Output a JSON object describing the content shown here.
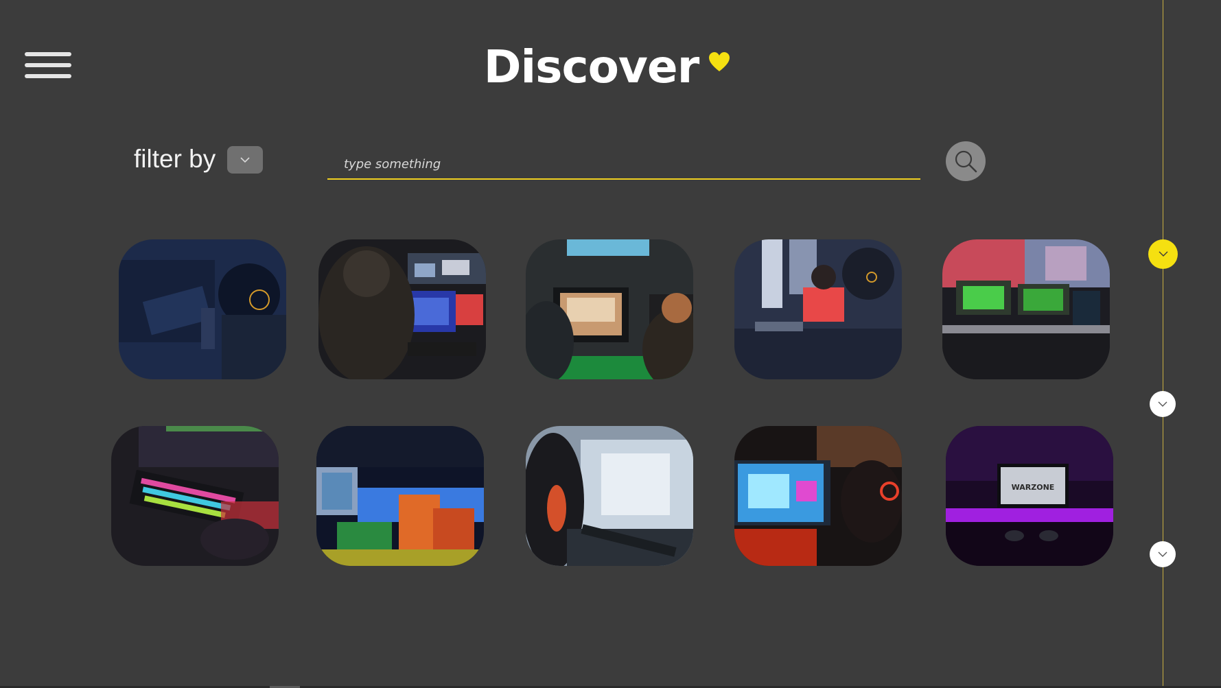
{
  "header": {
    "title": "Discover",
    "heart_icon": "heart-icon",
    "accent_color": "#f5e011"
  },
  "menu": {
    "icon": "hamburger-menu-icon"
  },
  "filter": {
    "label": "filter by",
    "dropdown_icon": "chevron-down-icon"
  },
  "search": {
    "placeholder": "type something",
    "value": "",
    "button_icon": "search-icon",
    "underline_color": "#f0d020"
  },
  "gallery": {
    "rows": 2,
    "columns": 5,
    "items": [
      {
        "name": "gamer-headset-desk"
      },
      {
        "name": "gamer-multiple-monitors"
      },
      {
        "name": "gaming-lounge-screens"
      },
      {
        "name": "esports-players-room"
      },
      {
        "name": "gaming-setup-dual-monitor"
      },
      {
        "name": "rgb-keyboard"
      },
      {
        "name": "esports-arena-stage"
      },
      {
        "name": "headset-gamer-keyboard"
      },
      {
        "name": "gamer-red-headset-monitor"
      },
      {
        "name": "warzone-purple-room"
      }
    ]
  },
  "timeline": {
    "steps": [
      {
        "name": "step-1",
        "active": true
      },
      {
        "name": "step-2",
        "active": false
      },
      {
        "name": "step-3",
        "active": false
      }
    ],
    "line_color": "#c8b040"
  }
}
